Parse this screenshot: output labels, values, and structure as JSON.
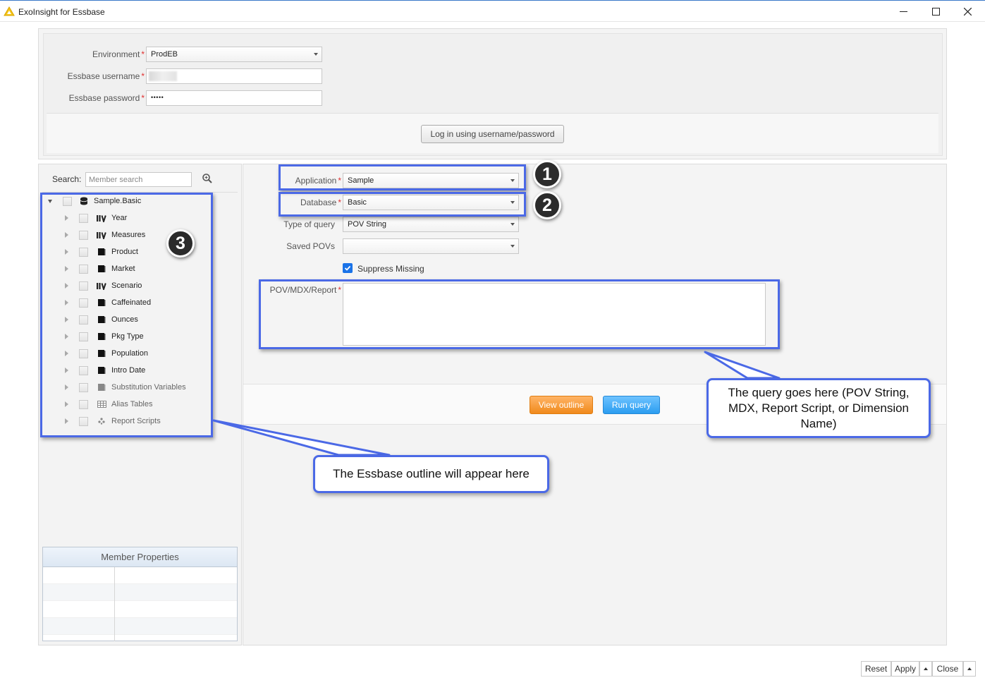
{
  "window": {
    "title": "ExoInsight for Essbase",
    "minimize": "—",
    "maximize": "☐",
    "close": "✕"
  },
  "login": {
    "environment_label": "Environment",
    "environment_value": "ProdEB",
    "username_label": "Essbase username",
    "username_value": "",
    "password_label": "Essbase password",
    "password_value": "•••••",
    "login_button": "Log in using username/password"
  },
  "search": {
    "label": "Search:",
    "placeholder": "Member search"
  },
  "tree": {
    "root": "Sample.Basic",
    "items": [
      {
        "label": "Year",
        "icon": "hierarchy-icon"
      },
      {
        "label": "Measures",
        "icon": "hierarchy-icon"
      },
      {
        "label": "Product",
        "icon": "dimension-icon"
      },
      {
        "label": "Market",
        "icon": "dimension-icon"
      },
      {
        "label": "Scenario",
        "icon": "hierarchy-icon"
      },
      {
        "label": "Caffeinated",
        "icon": "dimension-icon"
      },
      {
        "label": "Ounces",
        "icon": "dimension-icon"
      },
      {
        "label": "Pkg Type",
        "icon": "dimension-icon"
      },
      {
        "label": "Population",
        "icon": "dimension-icon"
      },
      {
        "label": "Intro Date",
        "icon": "dimension-icon"
      },
      {
        "label": "Substitution Variables",
        "icon": "variables-icon"
      },
      {
        "label": "Alias Tables",
        "icon": "table-icon"
      },
      {
        "label": "Report Scripts",
        "icon": "script-icon"
      }
    ]
  },
  "member_properties": {
    "title": "Member Properties"
  },
  "query": {
    "application_label": "Application",
    "application_value": "Sample",
    "database_label": "Database",
    "database_value": "Basic",
    "type_label": "Type of query",
    "type_value": "POV String",
    "saved_povs_label": "Saved POVs",
    "saved_povs_value": "",
    "suppress_missing_label": "Suppress Missing",
    "suppress_missing_checked": true,
    "pov_label": "POV/MDX/Report",
    "pov_value": "",
    "view_outline_button": "View outline",
    "run_query_button": "Run query"
  },
  "annotations": {
    "badge_1": "1",
    "badge_2": "2",
    "badge_3": "3",
    "callout_query": "The query goes here (POV String, MDX, Report Script, or Dimension Name)",
    "callout_outline": "The Essbase outline will appear here"
  },
  "footer": {
    "reset": "Reset",
    "apply": "Apply",
    "close": "Close"
  },
  "colors": {
    "accent_annotation": "#4b69e6",
    "view_outline_button": "#f08a1c",
    "run_query_button": "#2b9df0",
    "required_marker": "#e03030"
  }
}
